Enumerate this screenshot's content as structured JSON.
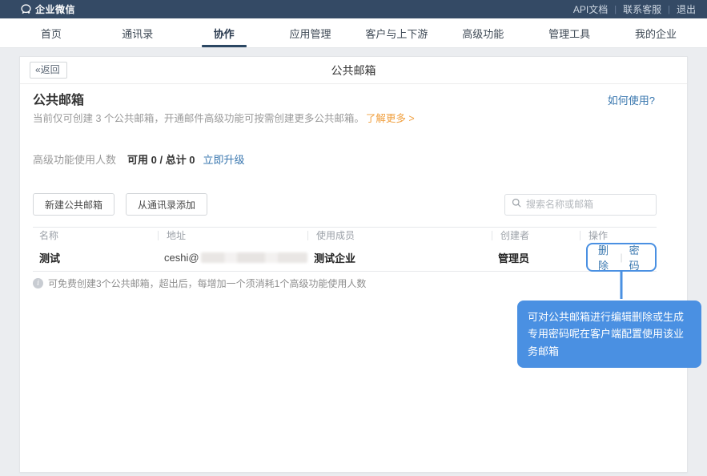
{
  "topbar": {
    "brand": "企业微信",
    "links": [
      "API文档",
      "联系客服",
      "退出"
    ]
  },
  "nav": {
    "items": [
      {
        "label": "首页"
      },
      {
        "label": "通讯录"
      },
      {
        "label": "协作"
      },
      {
        "label": "应用管理"
      },
      {
        "label": "客户与上下游"
      },
      {
        "label": "高级功能"
      },
      {
        "label": "管理工具"
      },
      {
        "label": "我的企业"
      }
    ]
  },
  "page": {
    "back_label": "«返回",
    "title": "公共邮箱"
  },
  "content": {
    "heading": "公共邮箱",
    "howto_link": "如何使用?",
    "description": "当前仅可创建 3 个公共邮箱，开通邮件高级功能可按需创建更多公共邮箱。",
    "learn_more": "了解更多 >",
    "stats": {
      "label": "高级功能使用人数",
      "value": "可用 0 / 总计 0",
      "upgrade_link": "立即升级"
    },
    "toolbar": {
      "new_button": "新建公共邮箱",
      "add_button": "从通讯录添加",
      "search_placeholder": "搜索名称或邮箱"
    },
    "table": {
      "headers": [
        "名称",
        "地址",
        "使用成员",
        "创建者",
        "操作"
      ],
      "row": {
        "name": "测试",
        "address_prefix": "ceshi@",
        "members": "测试企业",
        "creator": "管理员",
        "actions": [
          "删除",
          "密码"
        ]
      }
    },
    "note": "可免费创建3个公共邮箱，超出后，每增加一个须消耗1个高级功能使用人数",
    "tooltip": "可对公共邮箱进行编辑删除或生成专用密码呢在客户端配置使用该业务邮箱"
  },
  "colors": {
    "topbar": "#344a65",
    "accent_blue": "#4a90e2",
    "link_blue": "#3977af",
    "orange": "#f0a040"
  }
}
